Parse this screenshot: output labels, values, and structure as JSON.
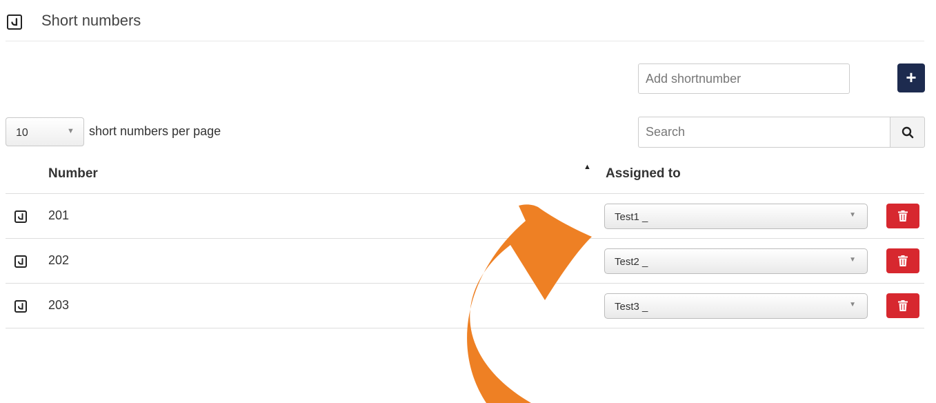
{
  "header": {
    "icon": "phone-icon",
    "title": "Short numbers"
  },
  "add": {
    "placeholder": "Add shortnumber",
    "button_label": "+"
  },
  "pagination": {
    "per_page_value": "10",
    "per_page_label": "short numbers per page"
  },
  "search": {
    "placeholder": "Search",
    "icon": "search-icon"
  },
  "table": {
    "columns": [
      "Number",
      "Assigned to"
    ],
    "sort_indicator": "▲",
    "rows": [
      {
        "number": "201",
        "assigned_to": "Test1 _"
      },
      {
        "number": "202",
        "assigned_to": "Test2 _"
      },
      {
        "number": "203",
        "assigned_to": "Test3 _"
      }
    ]
  },
  "colors": {
    "add_button": "#1d2b4f",
    "delete_button": "#d7282f",
    "annotation_arrow": "#ee8024"
  }
}
